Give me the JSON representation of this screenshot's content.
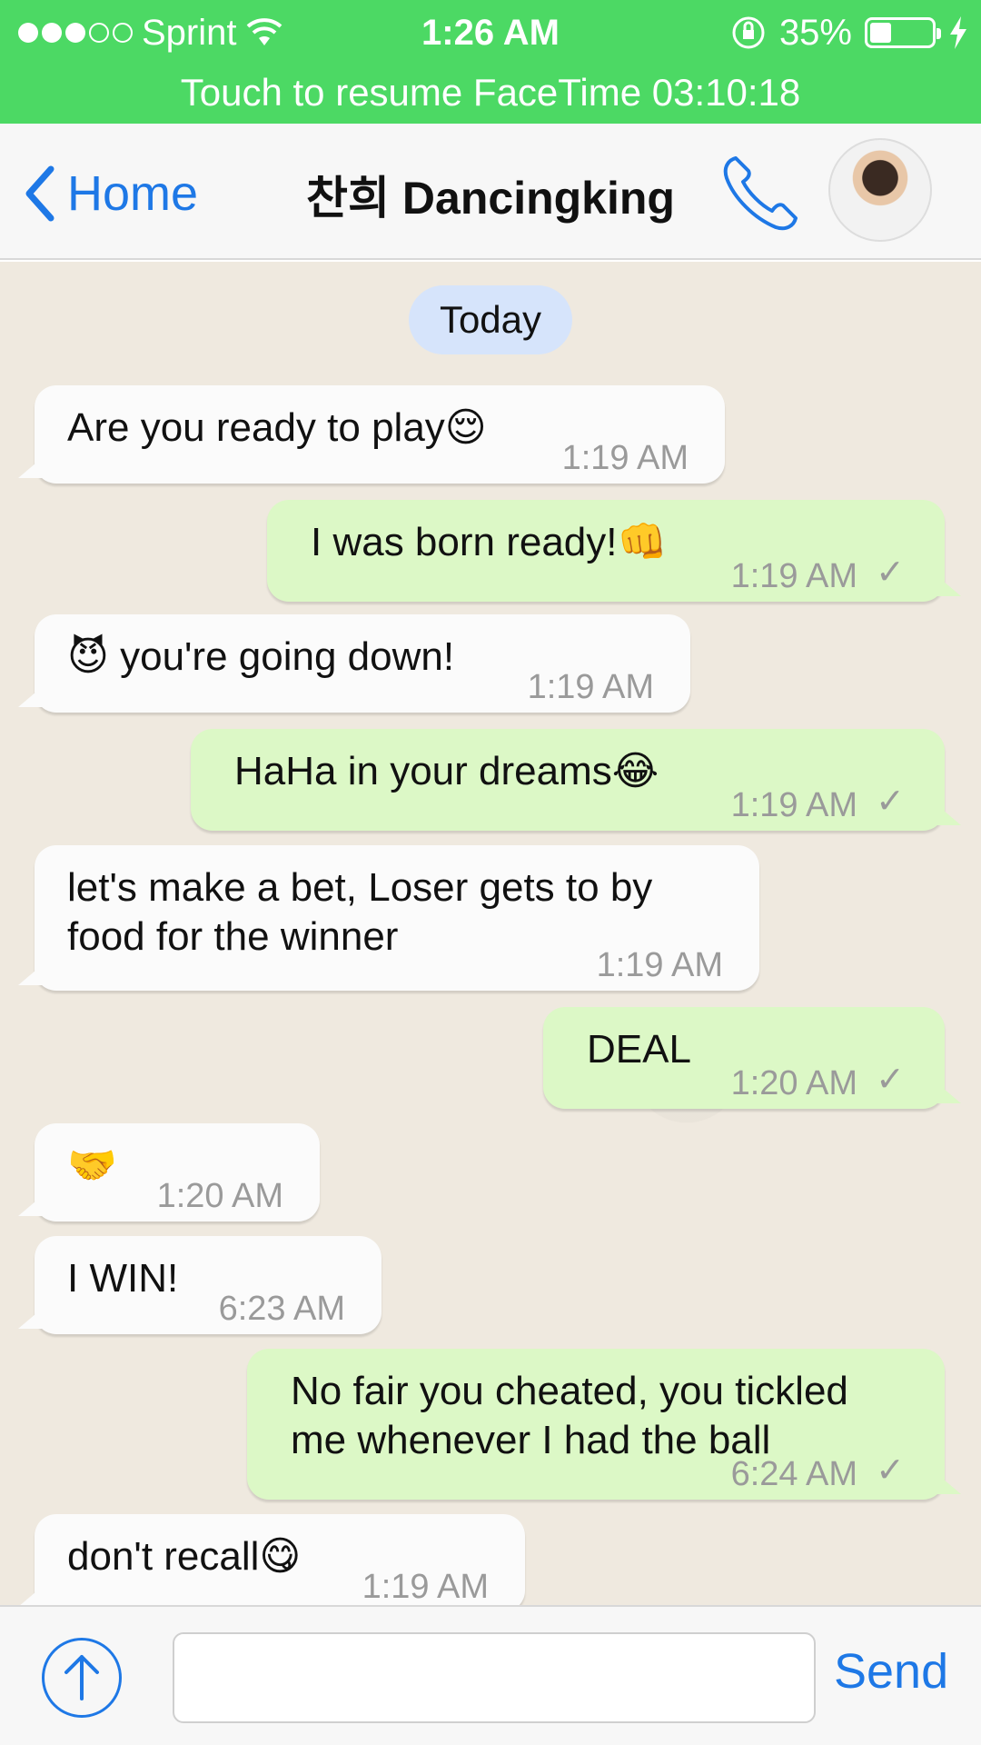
{
  "status": {
    "carrier": "Sprint",
    "time": "1:26 AM",
    "battery": "35%",
    "battery_level": 0.35
  },
  "banner": {
    "text": "Touch to resume FaceTime 03:10:18"
  },
  "nav": {
    "back_label": "Home",
    "title": "찬희 Dancingking"
  },
  "date_separator": "Today",
  "messages": [
    {
      "text": "Are you ready to play😌",
      "time": "1:19 AM",
      "direction": "in"
    },
    {
      "text": "I was born ready!👊",
      "time": "1:19 AM",
      "direction": "out"
    },
    {
      "text": "😈 you're going down!",
      "time": "1:19 AM",
      "direction": "in"
    },
    {
      "text": "HaHa in your dreams😂",
      "time": "1:19 AM",
      "direction": "out"
    },
    {
      "text": "let's make a bet, Loser gets to by food for the winner",
      "time": "1:19 AM",
      "direction": "in"
    },
    {
      "text": "DEAL",
      "time": "1:20 AM",
      "direction": "out"
    },
    {
      "text": "🤝",
      "time": "1:20 AM",
      "direction": "in"
    },
    {
      "text": "I WIN!",
      "time": "6:23 AM",
      "direction": "in"
    },
    {
      "text": "No fair you cheated, you tickled me whenever I had the ball",
      "time": "6:24 AM",
      "direction": "out"
    },
    {
      "text": "don't recall😋",
      "time": "1:19 AM",
      "direction": "in"
    }
  ],
  "composer": {
    "input_value": "",
    "send_label": "Send"
  }
}
